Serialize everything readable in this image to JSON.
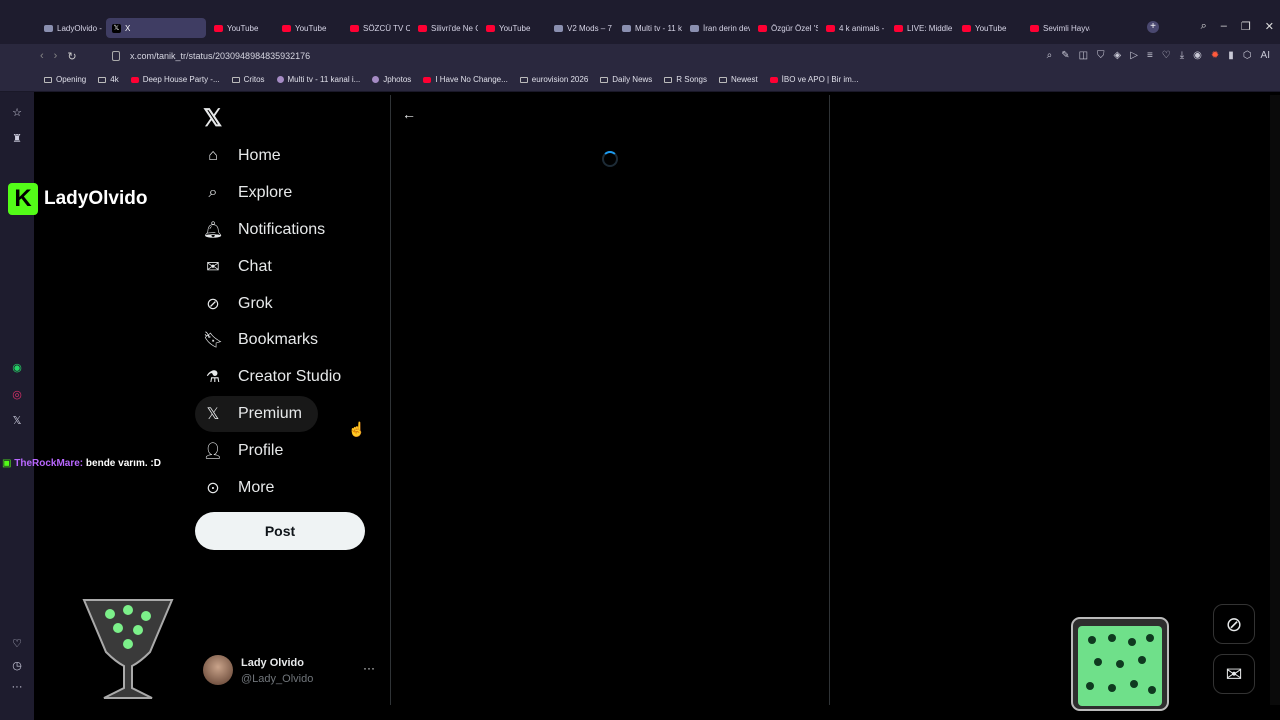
{
  "browser": {
    "tabs": [
      {
        "label": "LadyOlvido - I",
        "icon": "page-icon",
        "kind": "gen"
      },
      {
        "label": "X",
        "icon": "x-icon",
        "kind": "x",
        "active": true
      },
      {
        "label": "YouTube",
        "icon": "youtube-icon",
        "kind": "yt"
      },
      {
        "label": "YouTube",
        "icon": "youtube-icon",
        "kind": "yt"
      },
      {
        "label": "SÖZCÜ TV Ca",
        "icon": "youtube-icon",
        "kind": "yt"
      },
      {
        "label": "Silivri'de Ne C",
        "icon": "youtube-icon",
        "kind": "yt"
      },
      {
        "label": "YouTube",
        "icon": "youtube-icon",
        "kind": "yt"
      },
      {
        "label": "V2 Mods – 7 I",
        "icon": "page-icon",
        "kind": "gen"
      },
      {
        "label": "Multi tv - 11 k",
        "icon": "page-icon",
        "kind": "gen"
      },
      {
        "label": "İran derin dev",
        "icon": "page-icon",
        "kind": "gen"
      },
      {
        "label": "Özgür Özel 'S",
        "icon": "youtube-icon",
        "kind": "yt"
      },
      {
        "label": "4 k animals -",
        "icon": "youtube-icon",
        "kind": "yt"
      },
      {
        "label": "LIVE: Middle E",
        "icon": "youtube-icon",
        "kind": "yt"
      },
      {
        "label": "YouTube",
        "icon": "youtube-icon",
        "kind": "yt"
      },
      {
        "label": "Sevimli Hayva",
        "icon": "youtube-icon",
        "kind": "yt"
      }
    ],
    "url": "x.com/tanik_tr/status/2030948984835932176",
    "bookmarks": [
      {
        "label": "Opening",
        "kind": "folder"
      },
      {
        "label": "4k",
        "kind": "folder"
      },
      {
        "label": "Deep House Party -...",
        "kind": "yt"
      },
      {
        "label": "Critos",
        "kind": "folder"
      },
      {
        "label": "Multi tv - 11 kanal i...",
        "kind": "gen"
      },
      {
        "label": "Jphotos",
        "kind": "gen"
      },
      {
        "label": "I Have No Change...",
        "kind": "yt"
      },
      {
        "label": "eurovision 2026",
        "kind": "folder"
      },
      {
        "label": "Daily News",
        "kind": "folder"
      },
      {
        "label": "R Songs",
        "kind": "folder"
      },
      {
        "label": "Newest",
        "kind": "folder"
      },
      {
        "label": "İBO ve APO | Bir im...",
        "kind": "yt"
      }
    ],
    "ai_label": "AI"
  },
  "x": {
    "logo": "𝕏",
    "nav": [
      {
        "label": "Home",
        "icon": "home-icon",
        "glyph": "⌂"
      },
      {
        "label": "Explore",
        "icon": "search-icon",
        "glyph": "⌕"
      },
      {
        "label": "Notifications",
        "icon": "bell-icon",
        "glyph": "🔔︎"
      },
      {
        "label": "Chat",
        "icon": "mail-icon",
        "glyph": "✉"
      },
      {
        "label": "Grok",
        "icon": "grok-icon",
        "glyph": "⊘"
      },
      {
        "label": "Bookmarks",
        "icon": "bookmark-icon",
        "glyph": "🔖︎"
      },
      {
        "label": "Creator Studio",
        "icon": "flask-icon",
        "glyph": "⚗"
      },
      {
        "label": "Premium",
        "icon": "x-premium-icon",
        "glyph": "𝕏"
      },
      {
        "label": "Profile",
        "icon": "person-icon",
        "glyph": "👤︎"
      },
      {
        "label": "More",
        "icon": "more-circle-icon",
        "glyph": "⊙"
      }
    ],
    "post_label": "Post",
    "account": {
      "name": "Lady Olvido",
      "handle": "@Lady_Olvido",
      "more": "···"
    },
    "back": "←"
  },
  "overlay": {
    "brand_letter": "K",
    "brand_name": "LadyOlvido",
    "chat_user": "TheRockMare:",
    "chat_message": "bende varım. :D"
  },
  "colors": {
    "accent": "#1d9bf0",
    "kick_green": "#53fc18",
    "opera_red": "#ff1b2d"
  }
}
